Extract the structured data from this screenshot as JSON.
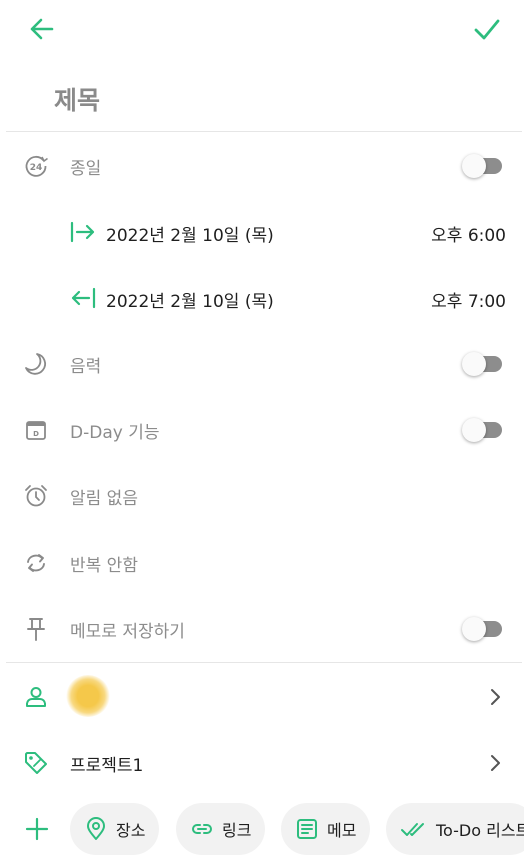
{
  "header": {
    "title_placeholder": "제목"
  },
  "settings": {
    "all_day": {
      "label": "종일",
      "on": false
    },
    "start": {
      "date": "2022년 2월 10일 (목)",
      "time": "오후 6:00"
    },
    "end": {
      "date": "2022년 2월 10일 (목)",
      "time": "오후 7:00"
    },
    "lunar": {
      "label": "음력",
      "on": false
    },
    "dday": {
      "label": "D-Day 기능",
      "on": false
    },
    "alarm": {
      "label": "알림 없음"
    },
    "repeat": {
      "label": "반복 안함"
    },
    "save_memo": {
      "label": "메모로 저장하기",
      "on": false
    }
  },
  "assign": {
    "project": "프로젝트1"
  },
  "chips": [
    {
      "label": "장소",
      "icon": "location-pin-icon"
    },
    {
      "label": "링크",
      "icon": "link-icon"
    },
    {
      "label": "메모",
      "icon": "note-icon"
    },
    {
      "label": "To-Do 리스트",
      "icon": "double-check-icon"
    }
  ],
  "colors": {
    "accent": "#2dbd7e",
    "icon_gray": "#8a8a8a",
    "toggle_track": "#8d8d8d"
  }
}
